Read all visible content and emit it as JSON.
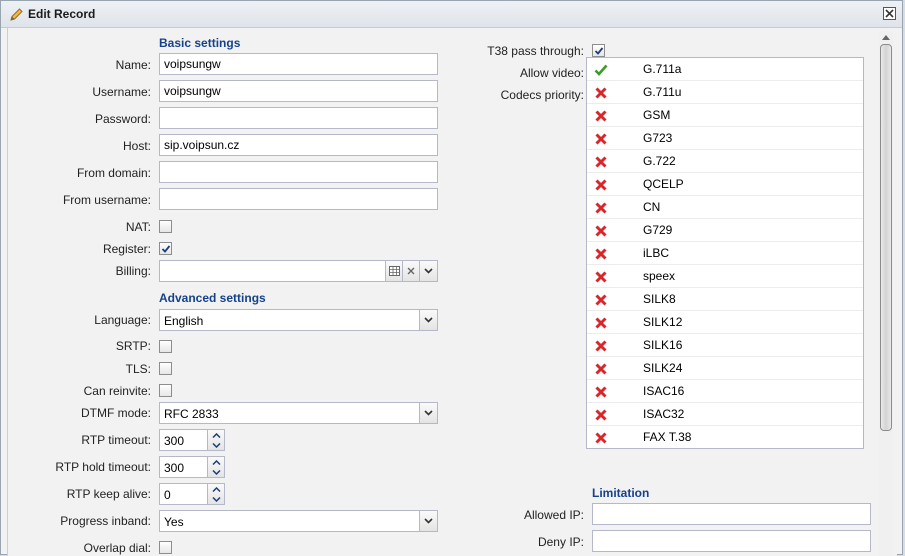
{
  "window": {
    "title": "Edit Record"
  },
  "basic": {
    "title": "Basic settings",
    "name": {
      "label": "Name:",
      "value": "voipsungw"
    },
    "username": {
      "label": "Username:",
      "value": "voipsungw"
    },
    "password": {
      "label": "Password:",
      "value": ""
    },
    "host": {
      "label": "Host:",
      "value": "sip.voipsun.cz"
    },
    "from_domain": {
      "label": "From domain:",
      "value": ""
    },
    "from_username": {
      "label": "From username:",
      "value": ""
    },
    "nat": {
      "label": "NAT:",
      "checked": false
    },
    "register": {
      "label": "Register:",
      "checked": true
    },
    "billing": {
      "label": "Billing:",
      "value": ""
    }
  },
  "advanced": {
    "title": "Advanced settings",
    "language": {
      "label": "Language:",
      "value": "English"
    },
    "srtp": {
      "label": "SRTP:",
      "checked": false
    },
    "tls": {
      "label": "TLS:",
      "checked": false
    },
    "can_reinvite": {
      "label": "Can reinvite:",
      "checked": false
    },
    "dtmf_mode": {
      "label": "DTMF mode:",
      "value": "RFC 2833"
    },
    "rtp_timeout": {
      "label": "RTP timeout:",
      "value": "300"
    },
    "rtp_hold_timeout": {
      "label": "RTP hold timeout:",
      "value": "300"
    },
    "rtp_keep_alive": {
      "label": "RTP keep alive:",
      "value": "0"
    },
    "progress_inband": {
      "label": "Progress inband:",
      "value": "Yes"
    },
    "overlap_dial": {
      "label": "Overlap dial:",
      "checked": false
    }
  },
  "right": {
    "t38": {
      "label": "T38 pass through:",
      "checked": true
    },
    "allow_video": {
      "label": "Allow video:",
      "checked": true
    },
    "codecs_label": "Codecs priority:",
    "codecs": [
      {
        "name": "G.711a",
        "enabled": true
      },
      {
        "name": "G.711u",
        "enabled": false
      },
      {
        "name": "GSM",
        "enabled": false
      },
      {
        "name": "G723",
        "enabled": false
      },
      {
        "name": "G.722",
        "enabled": false
      },
      {
        "name": "QCELP",
        "enabled": false
      },
      {
        "name": "CN",
        "enabled": false
      },
      {
        "name": "G729",
        "enabled": false
      },
      {
        "name": "iLBC",
        "enabled": false
      },
      {
        "name": "speex",
        "enabled": false
      },
      {
        "name": "SILK8",
        "enabled": false
      },
      {
        "name": "SILK12",
        "enabled": false
      },
      {
        "name": "SILK16",
        "enabled": false
      },
      {
        "name": "SILK24",
        "enabled": false
      },
      {
        "name": "ISAC16",
        "enabled": false
      },
      {
        "name": "ISAC32",
        "enabled": false
      },
      {
        "name": "FAX T.38",
        "enabled": false
      }
    ],
    "limitation_title": "Limitation",
    "allowed_ip": {
      "label": "Allowed IP:",
      "value": ""
    },
    "deny_ip": {
      "label": "Deny IP:",
      "value": ""
    }
  },
  "colors": {
    "section_title": "#15428b",
    "check_green": "#3a9d23",
    "cross_red": "#d9262b"
  },
  "icons": {
    "title": "pencil-icon",
    "close": "close-icon",
    "enabled": "check-icon",
    "disabled": "cross-icon"
  }
}
